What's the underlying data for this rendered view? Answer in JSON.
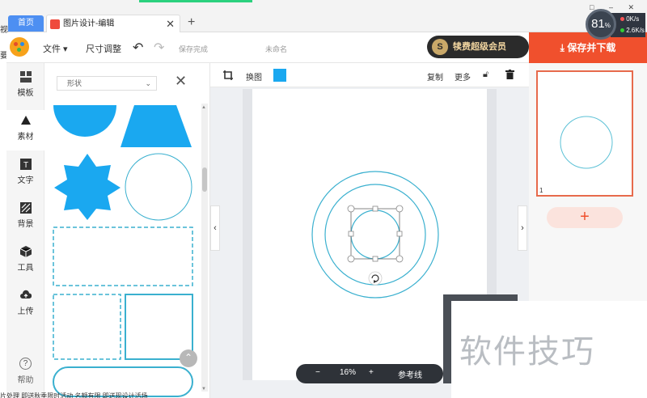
{
  "browser": {
    "tab_home": "首页",
    "tab_active": "图片设计-编辑",
    "tab_close": "✕",
    "tab_new": "+",
    "window_controls": "□ –  ✕",
    "edge_top": "视",
    "edge_left": "要",
    "bottom_text": "片处理  即送秋季限时活动  名额有限  即送现设计活场"
  },
  "speed_gauge": {
    "value": "81",
    "unit": "%",
    "up": "0K/s",
    "down": "2.6K/s"
  },
  "header": {
    "file_menu": "文件 ▾",
    "resize": "尺寸调整",
    "save_status": "保存完成",
    "doc_name": "未命名",
    "vip_label": "犊费超级会员",
    "vip_icon": "S",
    "save_download": "保存并下载"
  },
  "left_nav": {
    "items": [
      {
        "label": "模板",
        "icon": "template-icon"
      },
      {
        "label": "素材",
        "icon": "shapes-icon"
      },
      {
        "label": "文字",
        "icon": "text-icon"
      },
      {
        "label": "背景",
        "icon": "background-icon"
      },
      {
        "label": "工具",
        "icon": "tool-icon"
      },
      {
        "label": "上传",
        "icon": "upload-icon"
      }
    ],
    "help_icon": "?",
    "help": "帮助"
  },
  "asset_panel": {
    "category_select": "形状",
    "close": "✕",
    "collapse_icon": "⌃"
  },
  "canvas_toolbar": {
    "replace": "换图",
    "swatch_color": "#1aa8f0",
    "copy": "复制",
    "more": "更多"
  },
  "canvas_nav": {
    "left": "‹",
    "right": "›"
  },
  "zoom": {
    "minus": "−",
    "value": "16%",
    "plus": "+",
    "guides": "参考线"
  },
  "pages": {
    "page_number": "1",
    "add": "+"
  },
  "watermark": "软件技巧",
  "colors": {
    "accent": "#f0502d",
    "shape_blue": "#1aa8f0",
    "line_blue": "#3ab0cf"
  }
}
